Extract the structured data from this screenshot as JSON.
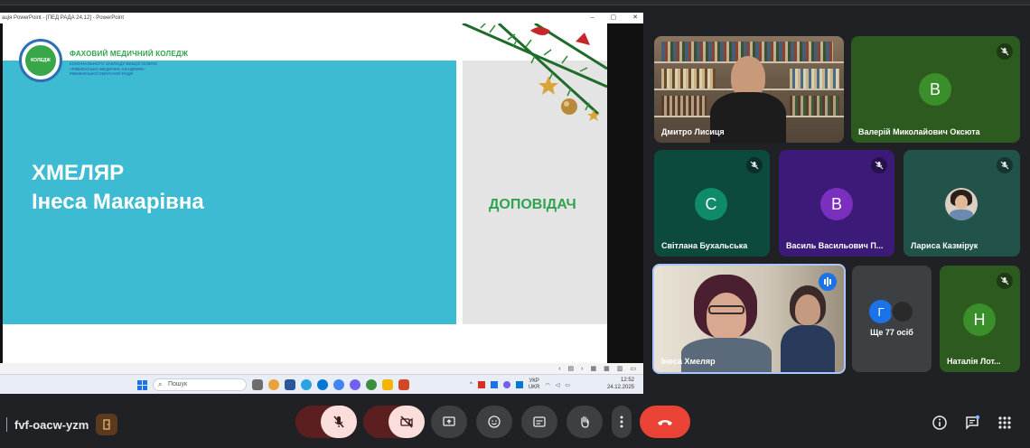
{
  "window": {
    "title": "ація PowerPoint - [ПЕД РАДА 24.12] - PowerPoint",
    "controls": [
      "–",
      "▢",
      "✕"
    ]
  },
  "slide": {
    "college_name": "ФАХОВИЙ МЕДИЧНИЙ КОЛЕДЖ",
    "college_sub": "КОМУНАЛЬНОГО ЗАКЛАДУ ВИЩОЇ ОСВІТИ «РІВНЕНСЬКА МЕДИЧНА АКАДЕМІЯ» РІВНЕНСЬКОЇ ОБЛАСНОЇ РАДИ",
    "logo_text": "КОЛЕДЖ",
    "speaker_surname": "ХМЕЛЯР",
    "speaker_name": "Інеса Макарівна",
    "role": "ДОПОВІДАЧ",
    "accent_teal": "#3dbbd2",
    "accent_green": "#2ea44f"
  },
  "taskbar": {
    "search_placeholder": "Пошук",
    "lang_top": "УКР",
    "lang_bottom": "UKR",
    "time": "12:52",
    "date": "24.12.2025"
  },
  "participants": [
    {
      "name": "Дмитро Лисиця",
      "type": "video"
    },
    {
      "name": "Валерій Миколайович Оксюта",
      "initial": "В",
      "avatar_color": "#3a8f2a",
      "muted": true
    },
    {
      "name": "Світлана Бухальська",
      "initial": "С",
      "avatar_color": "#0f8a6b",
      "muted": true
    },
    {
      "name": "Василь Васильович П...",
      "initial": "В",
      "avatar_color": "#7b2fbf",
      "muted": true
    },
    {
      "name": "Лариса Казмірук",
      "type": "photo",
      "muted": true
    },
    {
      "name": "Інеса Хмеляр",
      "type": "video",
      "speaking": true
    },
    {
      "others_label": "Ще 77 осіб",
      "initial": "Г",
      "avatar_color": "#1a73e8"
    },
    {
      "name": "Наталія Лот...",
      "initial": "Н",
      "avatar_color": "#3a8f2a",
      "muted": true
    }
  ],
  "meeting": {
    "code": "fvf-oacw-yzm"
  },
  "colors": {
    "end_call": "#ea4335",
    "muted_btn_bg": "#f9dedc",
    "speaking_border": "#a8c7fa"
  }
}
